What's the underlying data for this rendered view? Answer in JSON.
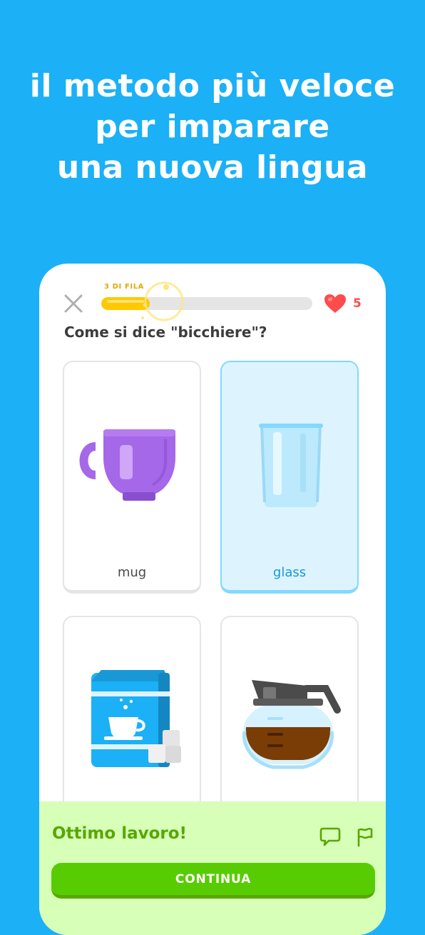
{
  "headline": {
    "line1": "il metodo più veloce",
    "line2": "per imparare",
    "line3": "una nuova lingua"
  },
  "lesson": {
    "streak_label": "3 DI FILA",
    "progress_fraction": 0.23,
    "hearts": "5",
    "question": "Come si dice \"bicchiere\"?"
  },
  "options": [
    {
      "label": "mug",
      "icon": "mug-icon",
      "selected": false
    },
    {
      "label": "glass",
      "icon": "glass-icon",
      "selected": true
    },
    {
      "label": "",
      "icon": "coffee-bag-icon",
      "selected": false
    },
    {
      "label": "",
      "icon": "coffee-pot-icon",
      "selected": false
    }
  ],
  "feedback": {
    "title": "Ottimo lavoro!",
    "continue_label": "CONTINUA",
    "icons": [
      "comment-icon",
      "flag-icon"
    ]
  },
  "colors": {
    "background": "#1CB0F6",
    "progress": "#FFC800",
    "heart": "#FF4B4B",
    "success": "#58CC02",
    "selected": "#1899D6"
  }
}
